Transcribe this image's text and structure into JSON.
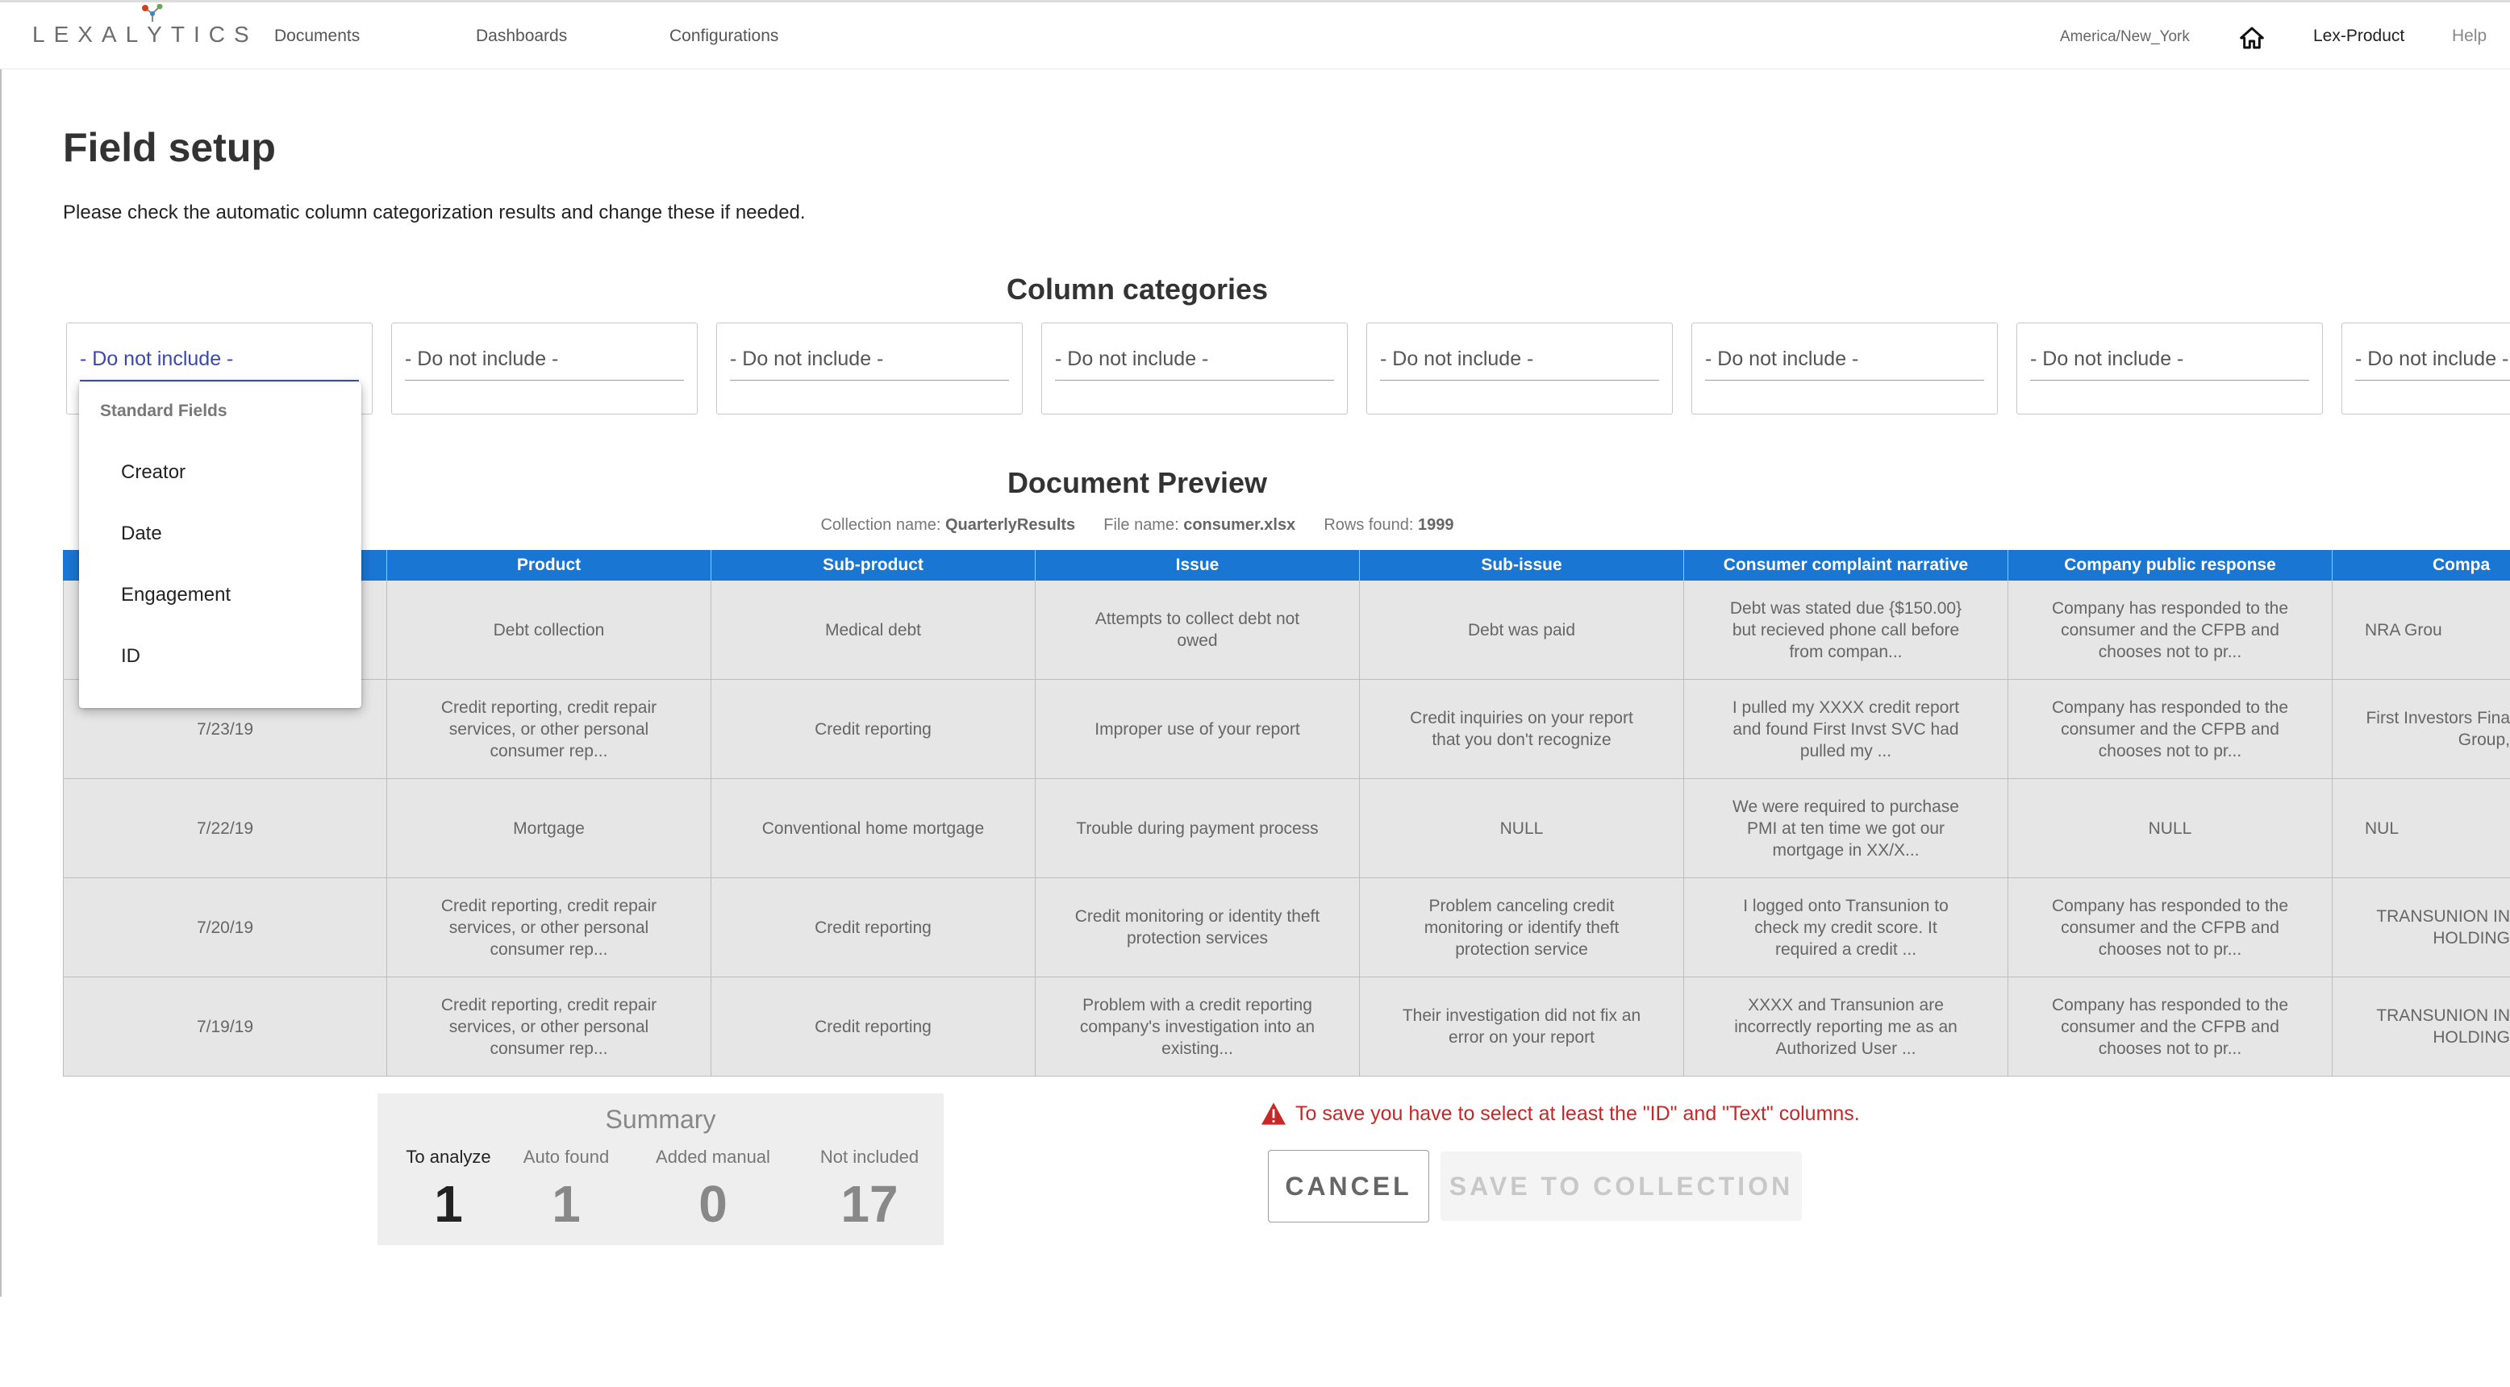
{
  "app": {
    "logo_text_pre": "LEXAL",
    "logo_text_y": "Y",
    "logo_text_post": "TICS"
  },
  "nav": {
    "documents": "Documents",
    "dashboards": "Dashboards",
    "configurations": "Configurations",
    "timezone": "America/New_York",
    "home_icon": "home-icon",
    "user": "Lex-Product",
    "help": "Help"
  },
  "page": {
    "title": "Field setup",
    "description": "Please check the automatic column categorization results and change these if needed."
  },
  "column_categories": {
    "title": "Column categories",
    "selects": [
      "- Do not include -",
      "- Do not include -",
      "- Do not include -",
      "- Do not include -",
      "- Do not include -",
      "- Do not include -",
      "- Do not include -",
      "- Do not include -"
    ],
    "dropdown": {
      "group_label": "Standard Fields",
      "options": [
        "Creator",
        "Date",
        "Engagement",
        "ID"
      ]
    }
  },
  "preview": {
    "title": "Document Preview",
    "collection_label": "Collection name:",
    "collection_value": "QuarterlyResults",
    "file_label": "File name:",
    "file_value": "consumer.xlsx",
    "rows_label": "Rows found:",
    "rows_value": "1999",
    "columns": [
      "",
      "Product",
      "Sub-product",
      "Issue",
      "Sub-issue",
      "Consumer complaint narrative",
      "Company public response",
      "Compa"
    ],
    "rows": [
      [
        "",
        "Debt collection",
        "Medical debt",
        "Attempts to collect debt not owed",
        "Debt was paid",
        "Debt was stated due {$150.00} but recieved phone call before from compan...",
        "Company has responded to the consumer and the CFPB and chooses not to pr...",
        "NRA Grou"
      ],
      [
        "7/23/19",
        "Credit reporting, credit repair services, or other personal consumer rep...",
        "Credit reporting",
        "Improper use of your report",
        "Credit inquiries on your report that you don't recognize",
        "I pulled my XXXX credit report and found First Invst SVC had pulled my ...",
        "Company has responded to the consumer and the CFPB and chooses not to pr...",
        "First Investors Fina Group,"
      ],
      [
        "7/22/19",
        "Mortgage",
        "Conventional home mortgage",
        "Trouble during payment process",
        "NULL",
        "We were required to purchase PMI at ten time we got our mortgage in XX/X...",
        "NULL",
        "NUL"
      ],
      [
        "7/20/19",
        "Credit reporting, credit repair services, or other personal consumer rep...",
        "Credit reporting",
        "Credit monitoring or identity theft protection services",
        "Problem canceling credit monitoring or identify theft protection service",
        "I logged onto Transunion to check my credit score. It required a credit ...",
        "Company has responded to the consumer and the CFPB and chooses not to pr...",
        "TRANSUNION IN HOLDING"
      ],
      [
        "7/19/19",
        "Credit reporting, credit repair services, or other personal consumer rep...",
        "Credit reporting",
        "Problem with a credit reporting company's investigation into an existing...",
        "Their investigation did not fix an error on your report",
        "XXXX and Transunion are incorrectly reporting me as an Authorized User ...",
        "Company has responded to the consumer and the CFPB and chooses not to pr...",
        "TRANSUNION IN HOLDING"
      ]
    ]
  },
  "summary": {
    "title": "Summary",
    "items": [
      {
        "label": "To analyze",
        "value": "1"
      },
      {
        "label": "Auto found",
        "value": "1"
      },
      {
        "label": "Added manual",
        "value": "0"
      },
      {
        "label": "Not included",
        "value": "17"
      }
    ]
  },
  "actions": {
    "warning": "To save you have to select at least the \"ID\" and \"Text\" columns.",
    "cancel": "CANCEL",
    "save": "SAVE TO COLLECTION"
  },
  "colors": {
    "table_header": "#1976d2",
    "warning": "#c62828",
    "active_select": "#3f51b5"
  }
}
